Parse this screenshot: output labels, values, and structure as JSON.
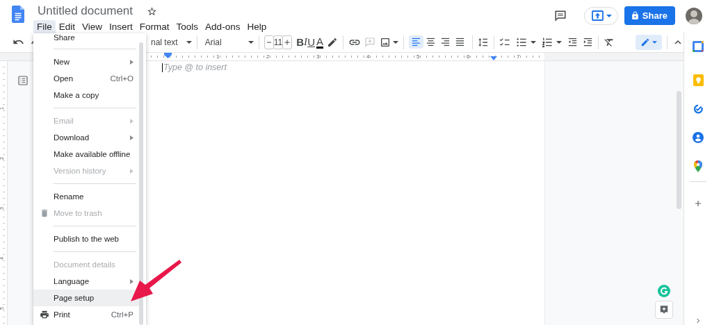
{
  "header": {
    "title": "Untitled document",
    "menus": [
      {
        "label": "File",
        "selected": true
      },
      {
        "label": "Edit",
        "selected": false
      },
      {
        "label": "View",
        "selected": false
      },
      {
        "label": "Insert",
        "selected": false
      },
      {
        "label": "Format",
        "selected": false
      },
      {
        "label": "Tools",
        "selected": false
      },
      {
        "label": "Add-ons",
        "selected": false
      },
      {
        "label": "Help",
        "selected": false
      }
    ],
    "share_button": {
      "label": "Share"
    }
  },
  "toolbar": {
    "text_style": "nal text",
    "font": "Arial",
    "font_size": "11",
    "format_buttons": [
      {
        "kind": "bold",
        "label": "B"
      },
      {
        "kind": "italic",
        "label": "I"
      },
      {
        "kind": "underline",
        "label": "U"
      },
      {
        "kind": "text-color",
        "label": "A"
      }
    ],
    "insert_comment": {
      "disabled": true
    },
    "alignment": [
      {
        "selected": true
      },
      {
        "selected": false
      },
      {
        "selected": false
      },
      {
        "selected": false
      }
    ],
    "editing_mode": {
      "selected": true
    }
  },
  "ruler": {
    "marks": [
      "1",
      "2",
      "3",
      "4",
      "5",
      "6",
      "7"
    ]
  },
  "vertical_ruler": {
    "marks": [
      "1",
      "2",
      "3",
      "4",
      "5"
    ]
  },
  "document": {
    "placeholder": "Type @ to insert"
  },
  "file_menu": {
    "items": [
      {
        "kind": "item",
        "label": "Share",
        "submenu": false,
        "disabled": false,
        "selected": false
      },
      {
        "kind": "separator"
      },
      {
        "kind": "item",
        "label": "New",
        "submenu": true,
        "disabled": false,
        "selected": false
      },
      {
        "kind": "item",
        "label": "Open",
        "shortcut": "Ctrl+O",
        "submenu": false,
        "disabled": false,
        "selected": false
      },
      {
        "kind": "item",
        "label": "Make a copy",
        "submenu": false,
        "disabled": false,
        "selected": false
      },
      {
        "kind": "separator"
      },
      {
        "kind": "item",
        "label": "Email",
        "submenu": true,
        "disabled": true,
        "selected": false
      },
      {
        "kind": "item",
        "label": "Download",
        "submenu": true,
        "disabled": false,
        "selected": false
      },
      {
        "kind": "item",
        "label": "Make available offline",
        "submenu": false,
        "disabled": false,
        "selected": false
      },
      {
        "kind": "item",
        "label": "Version history",
        "submenu": true,
        "disabled": true,
        "selected": false
      },
      {
        "kind": "separator"
      },
      {
        "kind": "item",
        "label": "Rename",
        "submenu": false,
        "disabled": false,
        "selected": false
      },
      {
        "kind": "item",
        "label": "Move to trash",
        "submenu": false,
        "disabled": true,
        "selected": false
      },
      {
        "kind": "separator"
      },
      {
        "kind": "item",
        "label": "Publish to the web",
        "submenu": false,
        "disabled": false,
        "selected": false
      },
      {
        "kind": "separator"
      },
      {
        "kind": "item",
        "label": "Document details",
        "submenu": false,
        "disabled": true,
        "selected": false
      },
      {
        "kind": "item",
        "label": "Language",
        "submenu": true,
        "disabled": false,
        "selected": false
      },
      {
        "kind": "item",
        "label": "Page setup",
        "submenu": false,
        "disabled": false,
        "selected": true
      },
      {
        "kind": "item",
        "label": "Print",
        "shortcut": "Ctrl+P",
        "submenu": false,
        "disabled": false,
        "selected": false
      }
    ]
  }
}
